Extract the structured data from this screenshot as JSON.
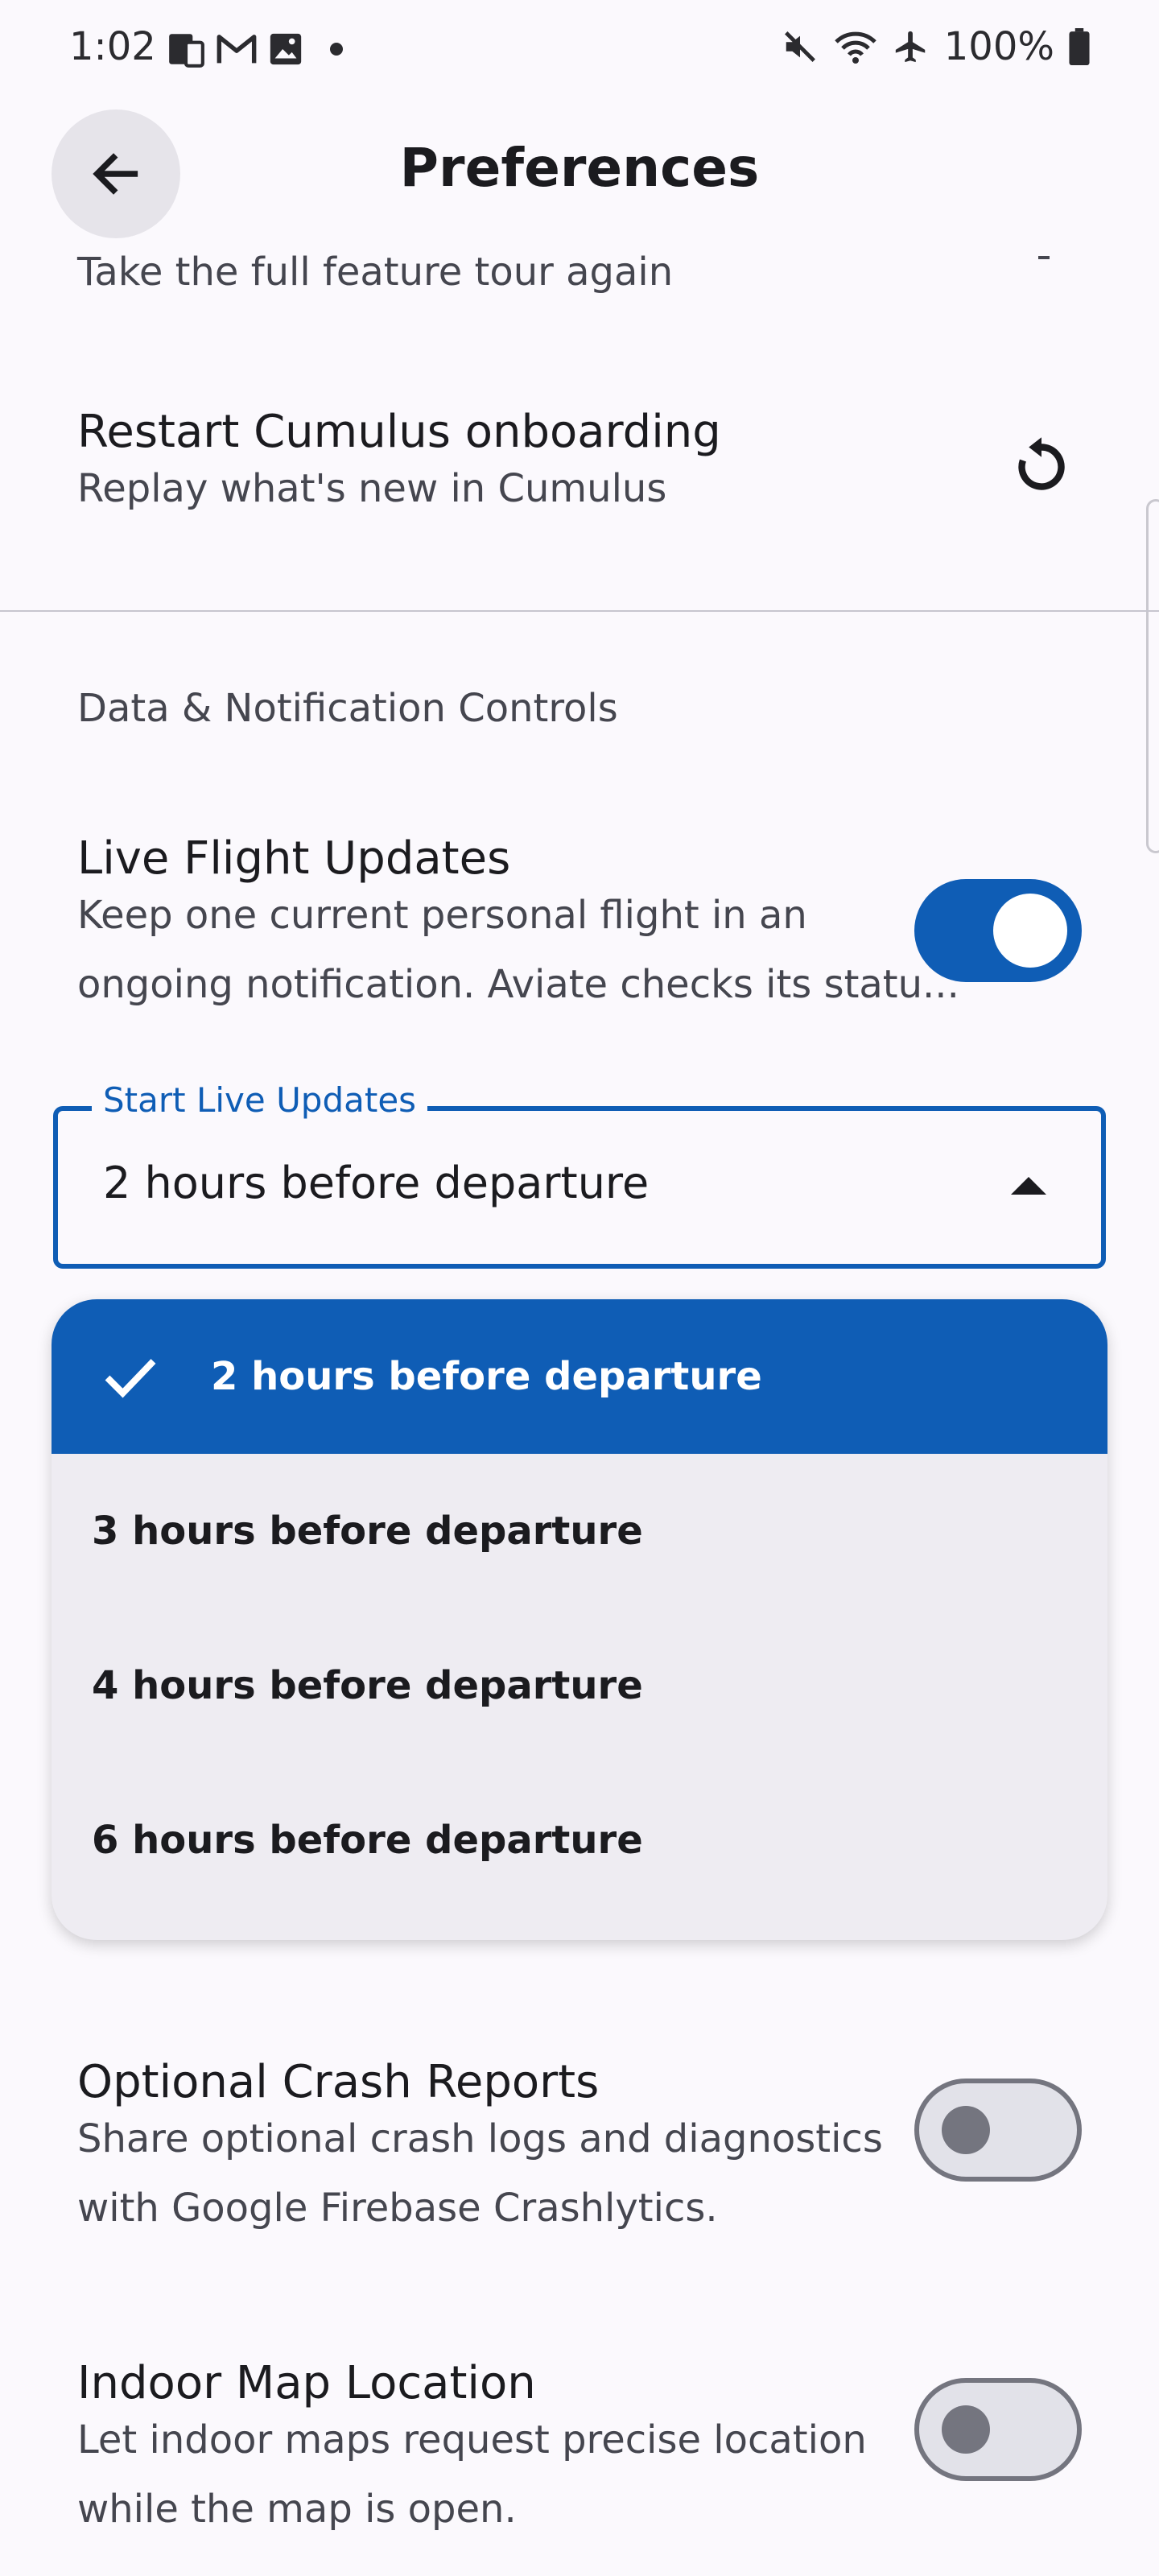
{
  "status_bar": {
    "time": "1:02",
    "left_icons": [
      "tablet-phone-icon",
      "gmail-icon",
      "image-icon",
      "dot-icon"
    ],
    "right_icons": [
      "mute-icon",
      "wifi-icon",
      "airplane-icon",
      "battery-icon"
    ],
    "battery": "100%"
  },
  "app_bar": {
    "title": "Preferences",
    "back_icon": "arrow-back-icon"
  },
  "partial_row_text": "Take the full feature tour again",
  "restart": {
    "title": "Restart Cumulus onboarding",
    "subtitle": "Replay what's new in Cumulus",
    "icon": "restart-icon"
  },
  "section": {
    "title": "Data & Notification Controls"
  },
  "live_updates": {
    "title": "Live Flight Updates",
    "subtitle_line1": "Keep one current personal flight in an",
    "subtitle_line2": "ongoing notification. Aviate checks its statu...",
    "enabled": true
  },
  "start_live_updates": {
    "label": "Start Live Updates",
    "value": "2 hours before departure",
    "options": [
      {
        "label": "2 hours before departure",
        "selected": true
      },
      {
        "label": "3 hours before departure",
        "selected": false
      },
      {
        "label": "4 hours before departure",
        "selected": false
      },
      {
        "label": "6 hours before departure",
        "selected": false
      }
    ]
  },
  "crash_reports": {
    "title": "Optional Crash Reports",
    "subtitle_line1": "Share optional crash logs and diagnostics",
    "subtitle_line2": "with Google Firebase Crashlytics.",
    "enabled": false
  },
  "indoor_map": {
    "title": "Indoor Map Location",
    "subtitle_line1": "Let indoor maps request precise location",
    "subtitle_line2": "while the map is open.",
    "enabled": false
  },
  "colors": {
    "accent": "#0f5db5",
    "background": "#fbf9fd",
    "menu_background": "#eeecf2"
  }
}
